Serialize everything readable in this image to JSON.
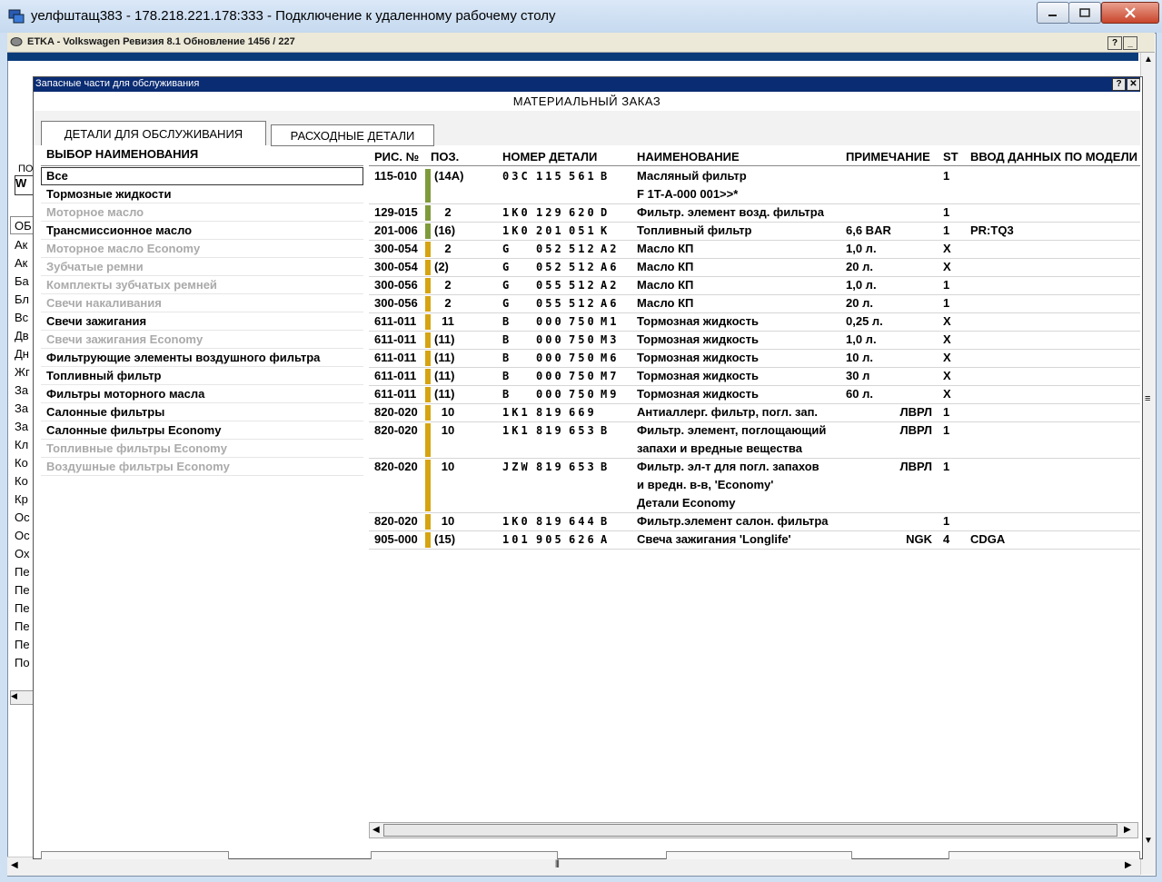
{
  "rdp": {
    "title": "уелфштащ383 - 178.218.221.178:333 - Подключение к удаленному рабочему столу",
    "min_icon": "minimize-icon",
    "max_icon": "maximize-icon",
    "close_icon": "close-icon"
  },
  "etka": {
    "title": "ETKA - Volkswagen Ревизия 8.1 Обновление 1456 / 227",
    "help": "?",
    "minimize": "_"
  },
  "background_list": {
    "fragment_a": "ПО",
    "input_fragment": "W",
    "header_fragment": "ОБ",
    "items": [
      "Ак",
      "Ак",
      "Ба",
      "Бл",
      "Вс",
      "Дв",
      "Дн",
      "Жг",
      "За",
      "За",
      "За",
      "Кл",
      "Ко",
      "Ко",
      "Кр",
      "Ос",
      "Ос",
      "Ох",
      "Пе",
      "Пе",
      "Пе",
      "Пе",
      "Пе",
      "По"
    ]
  },
  "dialog": {
    "title": "Запасные части для обслуживания",
    "help": "?",
    "close": "✕",
    "heading": "МАТЕРИАЛЬНЫЙ ЗАКАЗ",
    "tabs": {
      "service": "ДЕТАЛИ ДЛЯ ОБСЛУЖИВАНИЯ",
      "consumables": "РАСХОДНЫЕ ДЕТАЛИ"
    }
  },
  "left_panel": {
    "header": "ВЫБОР НАИМЕНОВАНИЯ",
    "items": [
      {
        "label": "Все",
        "dim": false
      },
      {
        "label": "Тормозные жидкости",
        "dim": false
      },
      {
        "label": "Моторное масло",
        "dim": true
      },
      {
        "label": "Трансмиссионное масло",
        "dim": false
      },
      {
        "label": "Моторное масло Economy",
        "dim": true
      },
      {
        "label": "Зубчатые ремни",
        "dim": true
      },
      {
        "label": "Комплекты зубчатых ремней",
        "dim": true
      },
      {
        "label": "Свечи накаливания",
        "dim": true
      },
      {
        "label": "Свечи зажигания",
        "dim": false
      },
      {
        "label": "Свечи зажигания Economy",
        "dim": true
      },
      {
        "label": "Фильтрующие элементы воздушного фильтра",
        "dim": false
      },
      {
        "label": "Топливный фильтр",
        "dim": false
      },
      {
        "label": "Фильтры моторного масла",
        "dim": false
      },
      {
        "label": "Салонные фильтры",
        "dim": false
      },
      {
        "label": "Салонные фильтры Economy",
        "dim": false
      },
      {
        "label": "Топливные фильтры Economy",
        "dim": true
      },
      {
        "label": "Воздушные фильтры Economy",
        "dim": true
      }
    ]
  },
  "table": {
    "headers": {
      "fig": "РИС. №",
      "pos": "ПОЗ.",
      "part": "НОМЕР ДЕТАЛИ",
      "name": "НАИМЕНОВАНИЕ",
      "note": "ПРИМЕЧАНИЕ",
      "st": "ST",
      "model": "ВВОД ДАННЫХ ПО МОДЕЛИ"
    },
    "colors": {
      "green": "#7f9a3a",
      "yellow": "#d6a412"
    },
    "rows": [
      {
        "fig": "115-010",
        "pos": "(14A)",
        "p1": "03C",
        "p2": "115",
        "p3": "561",
        "p4": "B",
        "name": [
          "Масляный фильтр",
          "F 1T-A-000 001>>*"
        ],
        "note": "",
        "st": "1",
        "model": "",
        "color": "green",
        "lines": 2
      },
      {
        "fig": "129-015",
        "pos": "2",
        "p1": "1K0",
        "p2": "129",
        "p3": "620",
        "p4": "D",
        "name": [
          "Фильтр. элемент возд. фильтра"
        ],
        "note": "",
        "st": "1",
        "model": "",
        "color": "green",
        "lines": 1
      },
      {
        "fig": "201-006",
        "pos": "(16)",
        "p1": "1K0",
        "p2": "201",
        "p3": "051",
        "p4": "K",
        "name": [
          "Топливный фильтр"
        ],
        "note": "6,6 BAR",
        "st": "1",
        "model": "PR:TQ3",
        "color": "green",
        "lines": 1
      },
      {
        "fig": "300-054",
        "pos": "2",
        "p1": "G",
        "p2": "052",
        "p3": "512",
        "p4": "A2",
        "name": [
          "Масло КП"
        ],
        "note": "1,0 л.",
        "st": "X",
        "model": "",
        "color": "yellow",
        "lines": 1
      },
      {
        "fig": "300-054",
        "pos": "(2)",
        "p1": "G",
        "p2": "052",
        "p3": "512",
        "p4": "A6",
        "name": [
          "Масло КП"
        ],
        "note": "20 л.",
        "st": "X",
        "model": "",
        "color": "yellow",
        "lines": 1
      },
      {
        "fig": "300-056",
        "pos": "2",
        "p1": "G",
        "p2": "055",
        "p3": "512",
        "p4": "A2",
        "name": [
          "Масло КП"
        ],
        "note": "1,0 л.",
        "st": "1",
        "model": "",
        "color": "yellow",
        "lines": 1
      },
      {
        "fig": "300-056",
        "pos": "2",
        "p1": "G",
        "p2": "055",
        "p3": "512",
        "p4": "A6",
        "name": [
          "Масло КП"
        ],
        "note": "20 л.",
        "st": "1",
        "model": "",
        "color": "yellow",
        "lines": 1
      },
      {
        "fig": "611-011",
        "pos": "11",
        "p1": "B",
        "p2": "000",
        "p3": "750",
        "p4": "M1",
        "name": [
          "Тормозная жидкость"
        ],
        "note": "0,25 л.",
        "st": "X",
        "model": "",
        "color": "yellow",
        "lines": 1
      },
      {
        "fig": "611-011",
        "pos": "(11)",
        "p1": "B",
        "p2": "000",
        "p3": "750",
        "p4": "M3",
        "name": [
          "Тормозная жидкость"
        ],
        "note": "1,0 л.",
        "st": "X",
        "model": "",
        "color": "yellow",
        "lines": 1
      },
      {
        "fig": "611-011",
        "pos": "(11)",
        "p1": "B",
        "p2": "000",
        "p3": "750",
        "p4": "M6",
        "name": [
          "Тормозная жидкость"
        ],
        "note": "10 л.",
        "st": "X",
        "model": "",
        "color": "yellow",
        "lines": 1
      },
      {
        "fig": "611-011",
        "pos": "(11)",
        "p1": "B",
        "p2": "000",
        "p3": "750",
        "p4": "M7",
        "name": [
          "Тормозная жидкость"
        ],
        "note": "30 л",
        "st": "X",
        "model": "",
        "color": "yellow",
        "lines": 1
      },
      {
        "fig": "611-011",
        "pos": "(11)",
        "p1": "B",
        "p2": "000",
        "p3": "750",
        "p4": "M9",
        "name": [
          "Тормозная жидкость"
        ],
        "note": "60 л.",
        "st": "X",
        "model": "",
        "color": "yellow",
        "lines": 1
      },
      {
        "fig": "820-020",
        "pos": "10",
        "p1": "1K1",
        "p2": "819",
        "p3": "669",
        "p4": "",
        "name": [
          "Антиаллерг. фильтр, погл. зап."
        ],
        "note": "ЛВРЛ",
        "st": "1",
        "model": "",
        "color": "yellow",
        "lines": 1,
        "note_right": true
      },
      {
        "fig": "820-020",
        "pos": "10",
        "p1": "1K1",
        "p2": "819",
        "p3": "653",
        "p4": "B",
        "name": [
          "Фильтр. элемент, поглощающий",
          "запахи и вредные вещества"
        ],
        "note": "ЛВРЛ",
        "st": "1",
        "model": "",
        "color": "yellow",
        "lines": 2,
        "note_right": true
      },
      {
        "fig": "820-020",
        "pos": "10",
        "p1": "JZW",
        "p2": "819",
        "p3": "653",
        "p4": "B",
        "name": [
          "Фильтр. эл-т для погл. запахов",
          "и вредн. в-в,  'Economy'",
          "Детали Economy"
        ],
        "note": "ЛВРЛ",
        "st": "1",
        "model": "",
        "color": "yellow",
        "lines": 3,
        "note_right": true
      },
      {
        "fig": "820-020",
        "pos": "10",
        "p1": "1K0",
        "p2": "819",
        "p3": "644",
        "p4": "B",
        "name": [
          "Фильтр.элемент салон. фильтра"
        ],
        "note": "",
        "st": "1",
        "model": "",
        "color": "yellow",
        "lines": 1
      },
      {
        "fig": "905-000",
        "pos": "(15)",
        "p1": "101",
        "p2": "905",
        "p3": "626",
        "p4": "A",
        "name": [
          "Свеча зажигания 'Longlife'"
        ],
        "note": "NGK",
        "st": "4",
        "model": "CDGA",
        "color": "yellow",
        "lines": 1,
        "note_right": true
      }
    ]
  }
}
